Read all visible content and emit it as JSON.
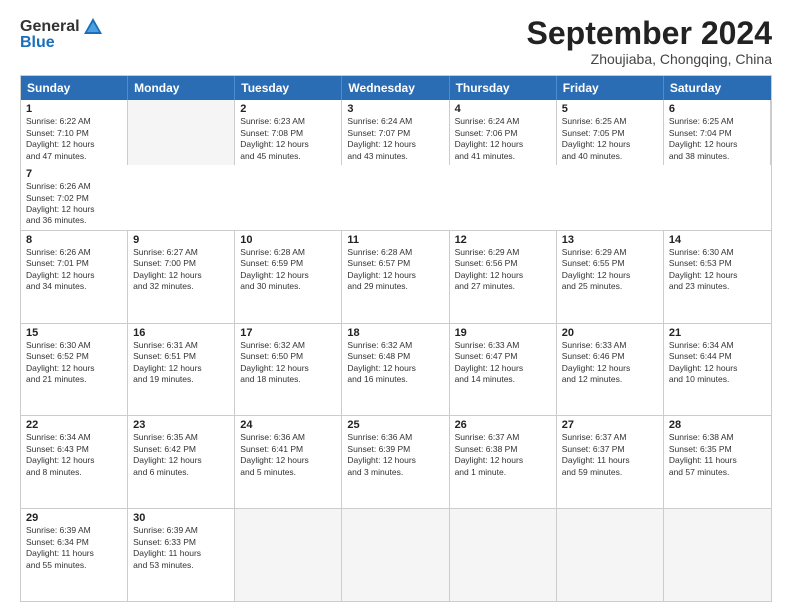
{
  "header": {
    "logo_general": "General",
    "logo_blue": "Blue",
    "month_title": "September 2024",
    "subtitle": "Zhoujiaba, Chongqing, China"
  },
  "calendar": {
    "days_of_week": [
      "Sunday",
      "Monday",
      "Tuesday",
      "Wednesday",
      "Thursday",
      "Friday",
      "Saturday"
    ],
    "rows": [
      [
        {
          "day": "",
          "text": ""
        },
        {
          "day": "2",
          "text": "Sunrise: 6:23 AM\nSunset: 7:08 PM\nDaylight: 12 hours\nand 45 minutes."
        },
        {
          "day": "3",
          "text": "Sunrise: 6:24 AM\nSunset: 7:07 PM\nDaylight: 12 hours\nand 43 minutes."
        },
        {
          "day": "4",
          "text": "Sunrise: 6:24 AM\nSunset: 7:06 PM\nDaylight: 12 hours\nand 41 minutes."
        },
        {
          "day": "5",
          "text": "Sunrise: 6:25 AM\nSunset: 7:05 PM\nDaylight: 12 hours\nand 40 minutes."
        },
        {
          "day": "6",
          "text": "Sunrise: 6:25 AM\nSunset: 7:04 PM\nDaylight: 12 hours\nand 38 minutes."
        },
        {
          "day": "7",
          "text": "Sunrise: 6:26 AM\nSunset: 7:02 PM\nDaylight: 12 hours\nand 36 minutes."
        }
      ],
      [
        {
          "day": "8",
          "text": "Sunrise: 6:26 AM\nSunset: 7:01 PM\nDaylight: 12 hours\nand 34 minutes."
        },
        {
          "day": "9",
          "text": "Sunrise: 6:27 AM\nSunset: 7:00 PM\nDaylight: 12 hours\nand 32 minutes."
        },
        {
          "day": "10",
          "text": "Sunrise: 6:28 AM\nSunset: 6:59 PM\nDaylight: 12 hours\nand 30 minutes."
        },
        {
          "day": "11",
          "text": "Sunrise: 6:28 AM\nSunset: 6:57 PM\nDaylight: 12 hours\nand 29 minutes."
        },
        {
          "day": "12",
          "text": "Sunrise: 6:29 AM\nSunset: 6:56 PM\nDaylight: 12 hours\nand 27 minutes."
        },
        {
          "day": "13",
          "text": "Sunrise: 6:29 AM\nSunset: 6:55 PM\nDaylight: 12 hours\nand 25 minutes."
        },
        {
          "day": "14",
          "text": "Sunrise: 6:30 AM\nSunset: 6:53 PM\nDaylight: 12 hours\nand 23 minutes."
        }
      ],
      [
        {
          "day": "15",
          "text": "Sunrise: 6:30 AM\nSunset: 6:52 PM\nDaylight: 12 hours\nand 21 minutes."
        },
        {
          "day": "16",
          "text": "Sunrise: 6:31 AM\nSunset: 6:51 PM\nDaylight: 12 hours\nand 19 minutes."
        },
        {
          "day": "17",
          "text": "Sunrise: 6:32 AM\nSunset: 6:50 PM\nDaylight: 12 hours\nand 18 minutes."
        },
        {
          "day": "18",
          "text": "Sunrise: 6:32 AM\nSunset: 6:48 PM\nDaylight: 12 hours\nand 16 minutes."
        },
        {
          "day": "19",
          "text": "Sunrise: 6:33 AM\nSunset: 6:47 PM\nDaylight: 12 hours\nand 14 minutes."
        },
        {
          "day": "20",
          "text": "Sunrise: 6:33 AM\nSunset: 6:46 PM\nDaylight: 12 hours\nand 12 minutes."
        },
        {
          "day": "21",
          "text": "Sunrise: 6:34 AM\nSunset: 6:44 PM\nDaylight: 12 hours\nand 10 minutes."
        }
      ],
      [
        {
          "day": "22",
          "text": "Sunrise: 6:34 AM\nSunset: 6:43 PM\nDaylight: 12 hours\nand 8 minutes."
        },
        {
          "day": "23",
          "text": "Sunrise: 6:35 AM\nSunset: 6:42 PM\nDaylight: 12 hours\nand 6 minutes."
        },
        {
          "day": "24",
          "text": "Sunrise: 6:36 AM\nSunset: 6:41 PM\nDaylight: 12 hours\nand 5 minutes."
        },
        {
          "day": "25",
          "text": "Sunrise: 6:36 AM\nSunset: 6:39 PM\nDaylight: 12 hours\nand 3 minutes."
        },
        {
          "day": "26",
          "text": "Sunrise: 6:37 AM\nSunset: 6:38 PM\nDaylight: 12 hours\nand 1 minute."
        },
        {
          "day": "27",
          "text": "Sunrise: 6:37 AM\nSunset: 6:37 PM\nDaylight: 11 hours\nand 59 minutes."
        },
        {
          "day": "28",
          "text": "Sunrise: 6:38 AM\nSunset: 6:35 PM\nDaylight: 11 hours\nand 57 minutes."
        }
      ],
      [
        {
          "day": "29",
          "text": "Sunrise: 6:39 AM\nSunset: 6:34 PM\nDaylight: 11 hours\nand 55 minutes."
        },
        {
          "day": "30",
          "text": "Sunrise: 6:39 AM\nSunset: 6:33 PM\nDaylight: 11 hours\nand 53 minutes."
        },
        {
          "day": "",
          "text": ""
        },
        {
          "day": "",
          "text": ""
        },
        {
          "day": "",
          "text": ""
        },
        {
          "day": "",
          "text": ""
        },
        {
          "day": "",
          "text": ""
        }
      ]
    ],
    "first_row_special": {
      "day": "1",
      "text": "Sunrise: 6:22 AM\nSunset: 7:10 PM\nDaylight: 12 hours\nand 47 minutes."
    }
  }
}
